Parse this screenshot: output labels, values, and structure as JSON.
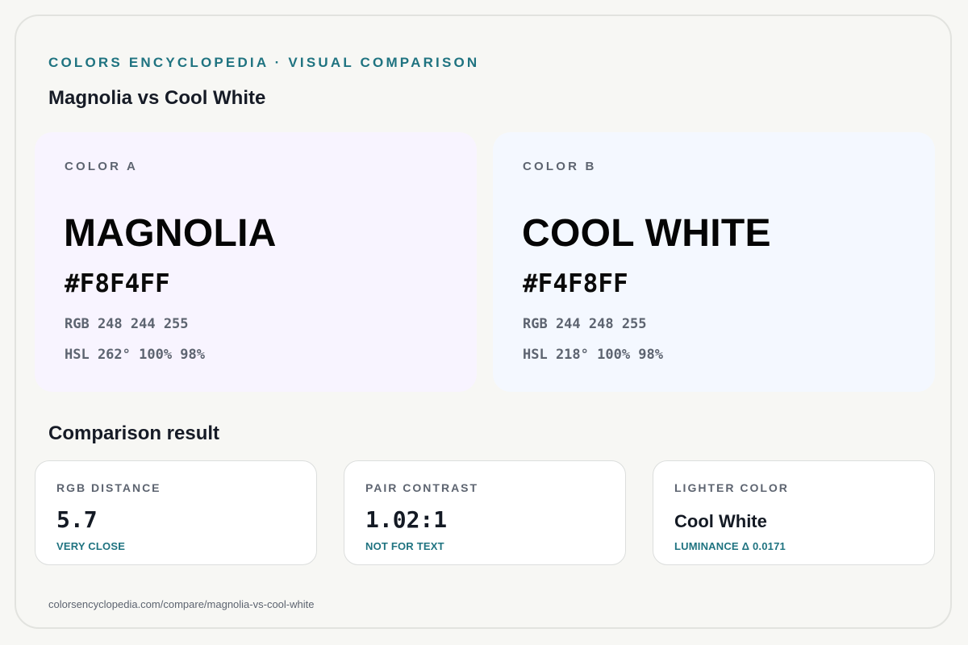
{
  "header": {
    "eyebrow": "COLORS ENCYCLOPEDIA · VISUAL COMPARISON",
    "title": "Magnolia vs Cool White"
  },
  "colors": [
    {
      "label": "COLOR A",
      "name": "MAGNOLIA",
      "hex": "#F8F4FF",
      "rgb": "RGB 248 244 255",
      "hsl": "HSL 262° 100% 98%",
      "swatch_color": "#f8f4ff"
    },
    {
      "label": "COLOR B",
      "name": "COOL WHITE",
      "hex": "#F4F8FF",
      "rgb": "RGB 244 248 255",
      "hsl": "HSL 218° 100% 98%",
      "swatch_color": "#f4f8ff"
    }
  ],
  "comparison": {
    "title": "Comparison result",
    "metrics": [
      {
        "label": "RGB DISTANCE",
        "value": "5.7",
        "note": "VERY CLOSE"
      },
      {
        "label": "PAIR CONTRAST",
        "value": "1.02:1",
        "note": "NOT FOR TEXT"
      },
      {
        "label": "LIGHTER COLOR",
        "value": "Cool White",
        "note": "LUMINANCE Δ 0.0171"
      }
    ]
  },
  "footer": {
    "url": "colorsencyclopedia.com/compare/magnolia-vs-cool-white"
  },
  "theme": {
    "accent": "#1f7380",
    "muted_text": "#5d6470",
    "background": "#f7f7f4"
  }
}
